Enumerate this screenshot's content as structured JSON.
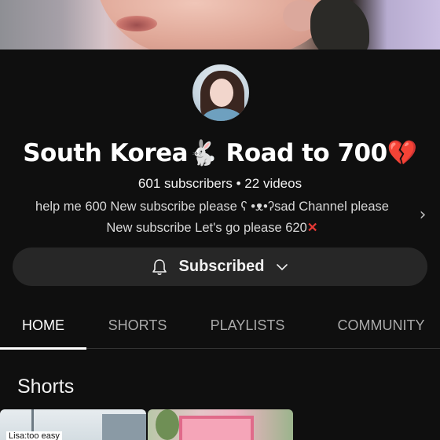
{
  "channel": {
    "title_main": "South Korea",
    "title_emoji": "🐇",
    "title_rest": " Road to 700",
    "title_heart": "💔",
    "meta": "601 subscribers • 22 videos",
    "description_line1": "help me 600 New subscribe please ʕ •ᴥ•ʔsad Channel please",
    "description_line2": "New subscribe Let's go please 620",
    "description_mark": "✕"
  },
  "subscribe_button": {
    "label": "Subscribed"
  },
  "tabs": [
    {
      "label": "HOME",
      "active": true
    },
    {
      "label": "SHORTS",
      "active": false
    },
    {
      "label": "PLAYLISTS",
      "active": false
    },
    {
      "label": "COMMUNITY",
      "active": false
    }
  ],
  "sections": {
    "shorts_title": "Shorts"
  },
  "thumbnails": [
    {
      "caption": "Lisa:too easy"
    },
    {
      "caption": ""
    }
  ],
  "icons": {
    "bell": "bell-icon",
    "chevron_down": "chevron-down-icon",
    "chevron_right": "chevron-right-icon"
  },
  "colors": {
    "background": "#0f0f0f",
    "button_bg": "#272727",
    "heart": "#f4508a",
    "cross": "#e53935"
  }
}
